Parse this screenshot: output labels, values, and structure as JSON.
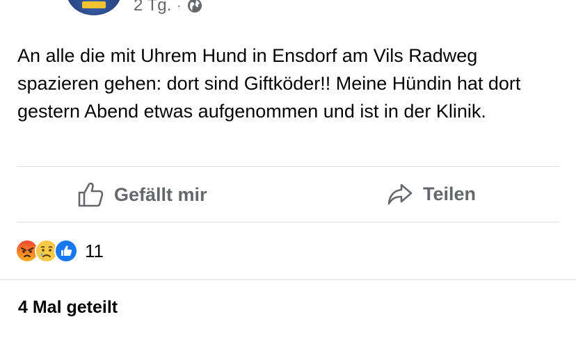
{
  "post": {
    "timestamp": "2 Tg.",
    "separator": "·",
    "privacy_icon": "globe-icon",
    "text": "An alle die mit Uhrem Hund in Ensdorf am Vils Radweg spazieren gehen: dort sind Giftköder!! Meine Hündin hat dort gestern Abend etwas aufgenommen und ist in der Klinik."
  },
  "actions": {
    "like_label": "Gefällt mir",
    "share_label": "Teilen",
    "like_icon": "thumbs-up-icon",
    "share_icon": "share-arrow-icon"
  },
  "reactions": {
    "icons": [
      "angry-reaction-icon",
      "sad-reaction-icon",
      "like-reaction-icon"
    ],
    "count": "11"
  },
  "shares": {
    "label": "4 Mal geteilt"
  },
  "colors": {
    "text": "#050505",
    "secondary_text": "#65676b",
    "divider": "#dadde1",
    "like_blue": "#1877f2"
  }
}
